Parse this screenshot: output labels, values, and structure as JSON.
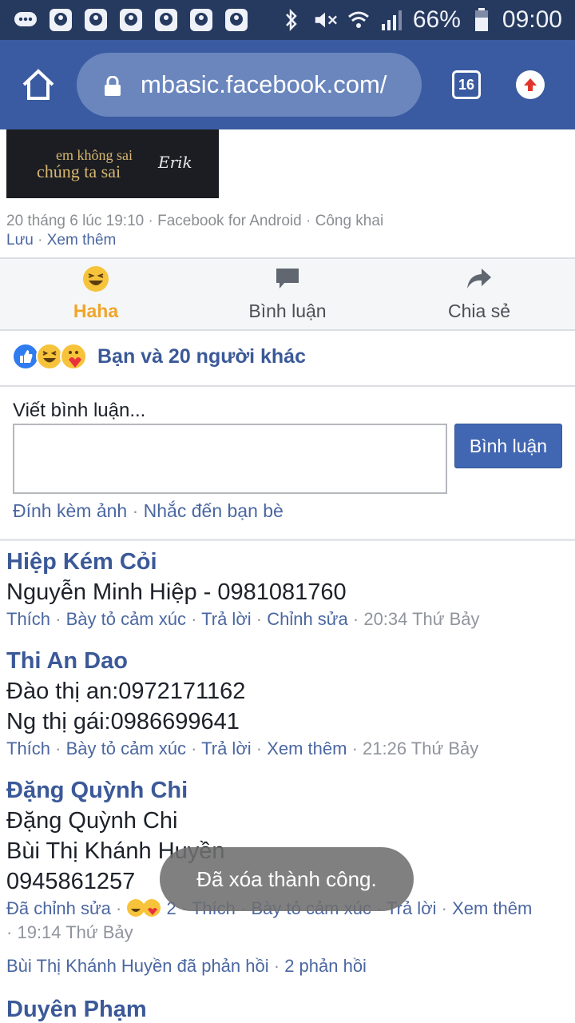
{
  "status_bar": {
    "battery": "66%",
    "time": "09:00",
    "icons": [
      "messenger-icon",
      "app-icon",
      "app-icon",
      "app-icon",
      "app-icon",
      "app-icon",
      "app-icon",
      "bluetooth-icon",
      "mute-icon",
      "wifi-icon",
      "signal-icon",
      "battery-icon"
    ]
  },
  "browser": {
    "url": "mbasic.facebook.com/",
    "tab_count": "16"
  },
  "post": {
    "image_text_line1": "em không sai",
    "image_text_line2": "chúng ta sai",
    "image_signature": "Erik",
    "date": "20 tháng 6 lúc 19:10",
    "source": "Facebook for Android",
    "privacy": "Công khai",
    "save": "Lưu",
    "see_more": "Xem thêm"
  },
  "actions": {
    "react_label": "Haha",
    "comment_label": "Bình luận",
    "share_label": "Chia sẻ"
  },
  "reactions_summary": "Bạn và 20 người khác",
  "composer": {
    "label": "Viết bình luận...",
    "button": "Bình luận",
    "attach_photo": "Đính kèm ảnh",
    "mention_friends": "Nhắc đến bạn bè"
  },
  "comments": [
    {
      "author": "Hiệp Kém Cỏi",
      "lines": [
        "Nguyễn Minh Hiệp - 0981081760"
      ],
      "like": "Thích",
      "react": "Bày tỏ cảm xúc",
      "reply": "Trả lời",
      "extra": "Chỉnh sửa",
      "time": "20:34 Thứ Bảy"
    },
    {
      "author": "Thi An Dao",
      "lines": [
        "Đào thị an:0972171162",
        "Ng thị gái:0986699641"
      ],
      "like": "Thích",
      "react": "Bày tỏ cảm xúc",
      "reply": "Trả lời",
      "extra": "Xem thêm",
      "time": "21:26 Thứ Bảy"
    },
    {
      "author": "Đặng Quỳnh Chi",
      "lines": [
        "Đặng Quỳnh Chi",
        "Bùi Thị Khánh Huyền",
        "0945861257"
      ],
      "edited": "Đã chỉnh sửa",
      "reaction_count": "2",
      "like": "Thích",
      "react": "Bày tỏ cảm xúc",
      "reply": "Trả lời",
      "extra": "Xem thêm",
      "time": "19:14 Thứ Bảy",
      "replies_line": "Bùi Thị Khánh Huyền đã phản hồi",
      "replies_count": "2 phản hồi"
    },
    {
      "author": "Duyên Phạm"
    }
  ],
  "toast": "Đã xóa thành công.",
  "colors": {
    "status_bar": "#26395f",
    "url_bar": "#3a5ba1",
    "facebook_blue": "#3b5998",
    "haha_yellow": "#f0a52a",
    "button_blue": "#4267b2"
  }
}
